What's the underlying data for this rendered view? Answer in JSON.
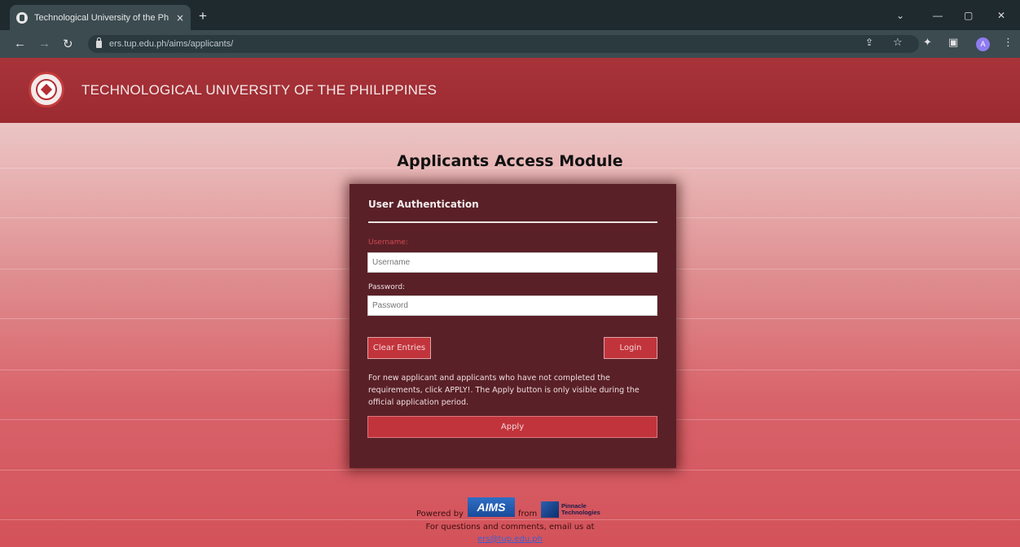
{
  "browser": {
    "tab_title": "Technological University of the Philippines",
    "tab_close": "×",
    "new_tab": "+",
    "url": "ers.tup.edu.ph/aims/applicants/",
    "avatar_letter": "A",
    "win_controls": [
      "⌄",
      "—",
      "▢",
      "✕"
    ]
  },
  "header": {
    "site_title": "TECHNOLOGICAL UNIVERSITY OF THE PHILIPPINES"
  },
  "main": {
    "module_title": "Applicants Access Module"
  },
  "auth": {
    "panel_title": "User Authentication",
    "username_label": "Username:",
    "username_placeholder": "Username",
    "password_label": "Password:",
    "password_placeholder": "Password",
    "clear_label": "Clear Entries",
    "login_label": "Login",
    "note": "For new applicant and applicants who have not completed the requirements, click APPLY!. The Apply button is only visible during the official application period.",
    "apply_label": "Apply"
  },
  "footer": {
    "powered_by": "Powered by",
    "aims_logo": "AIMS",
    "from": "from",
    "pinnacle_line1": "Pinnacle",
    "pinnacle_line2": "Technologies",
    "questions": "For questions and comments, email us at",
    "email": "ers@tup.edu.ph"
  },
  "colors": {
    "header_bg": "#9b2a30",
    "panel_bg": "#5a2027",
    "button_bg": "#c2343c",
    "username_label": "#d24b52"
  }
}
